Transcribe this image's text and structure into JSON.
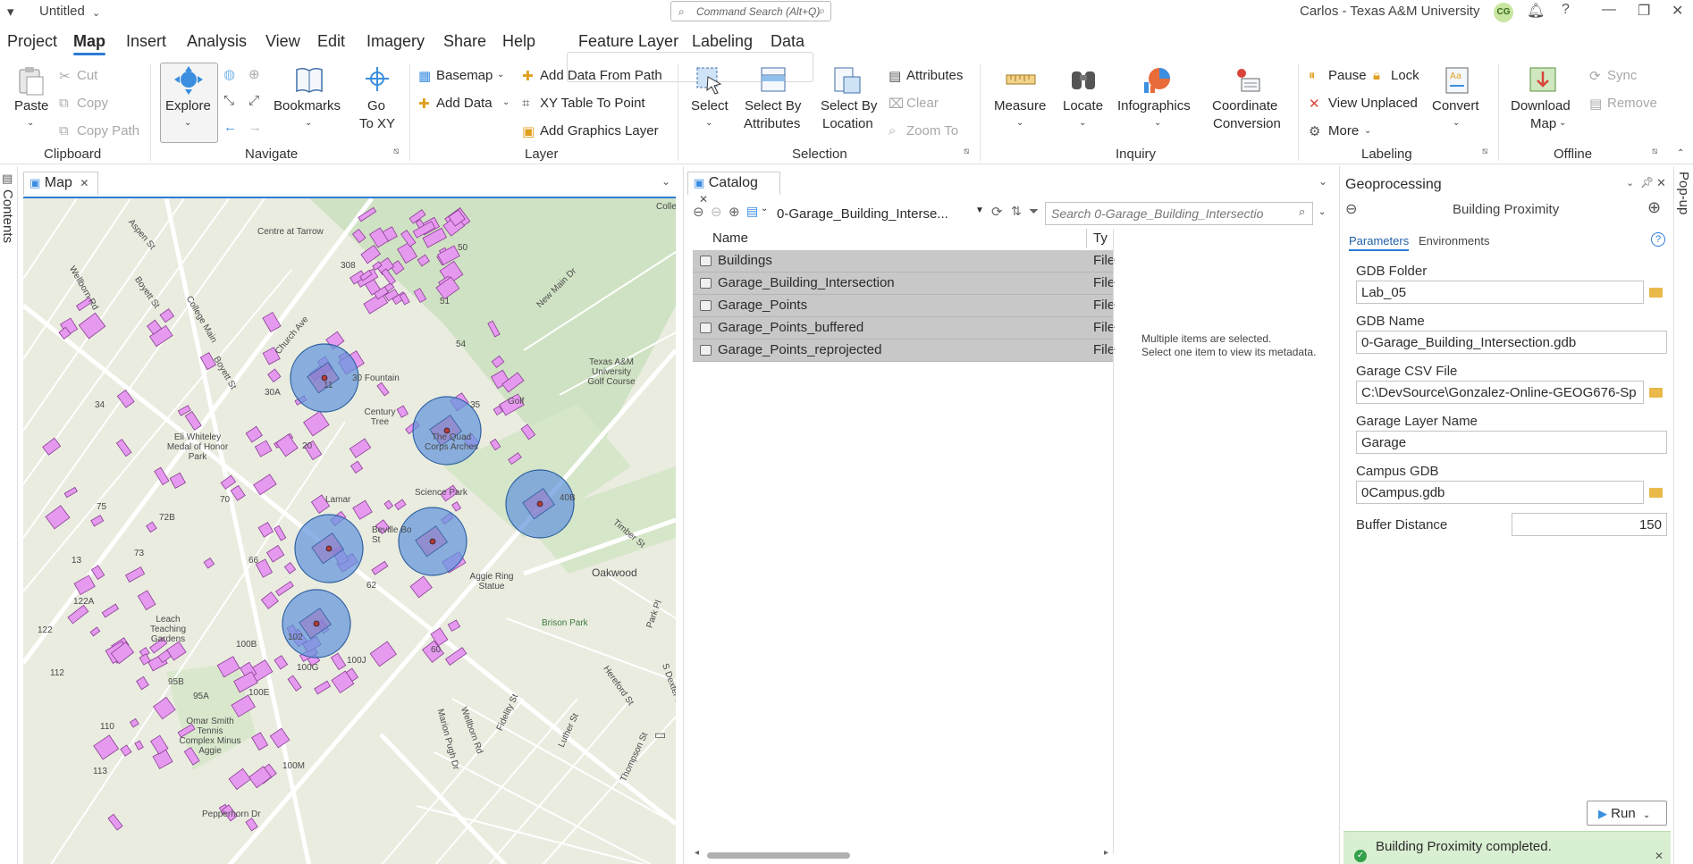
{
  "titlebar": {
    "doc_title": "Untitled",
    "search_placeholder": "Command Search (Alt+Q)",
    "user": "Carlos - Texas A&M University",
    "avatar_initials": "CG"
  },
  "menu": {
    "tabs": [
      "Project",
      "Map",
      "Insert",
      "Analysis",
      "View",
      "Edit",
      "Imagery",
      "Share",
      "Help"
    ],
    "active": "Map",
    "context_tabs": [
      "Feature Layer",
      "Labeling",
      "Data"
    ]
  },
  "ribbon": {
    "clipboard": {
      "label": "Clipboard",
      "paste": "Paste",
      "cut": "Cut",
      "copy": "Copy",
      "copy_path": "Copy Path"
    },
    "navigate": {
      "label": "Navigate",
      "explore": "Explore",
      "bookmarks": "Bookmarks",
      "goto_line1": "Go",
      "goto_line2": "To XY"
    },
    "layer": {
      "label": "Layer",
      "basemap": "Basemap",
      "add_data": "Add Data",
      "add_data_from_path": "Add Data From Path",
      "xy_table": "XY Table To Point",
      "add_graphics": "Add Graphics Layer"
    },
    "selection": {
      "label": "Selection",
      "select": "Select",
      "by_attr_1": "Select By",
      "by_attr_2": "Attributes",
      "by_loc_1": "Select By",
      "by_loc_2": "Location",
      "attributes": "Attributes",
      "clear": "Clear",
      "zoom_to": "Zoom To"
    },
    "inquiry": {
      "label": "Inquiry",
      "measure": "Measure",
      "locate": "Locate",
      "infographics": "Infographics",
      "coord_1": "Coordinate",
      "coord_2": "Conversion"
    },
    "labeling": {
      "label": "Labeling",
      "pause": "Pause",
      "lock": "Lock",
      "view_unplaced": "View Unplaced",
      "more": "More",
      "convert": "Convert"
    },
    "offline": {
      "label": "Offline",
      "download_1": "Download",
      "download_2": "Map",
      "sync": "Sync",
      "remove": "Remove"
    }
  },
  "sidepanels": {
    "contents": "Contents",
    "popup": "Pop-up"
  },
  "map_pane": {
    "tab_label": "Map",
    "labels": {
      "aspen": "Aspen St",
      "wellborn": "Wellborn Rd",
      "boyett": "Boyett St",
      "college_main": "College Main",
      "boyett2": "Boyett St",
      "church": "Church Ave",
      "centre": "Centre at Tarrow",
      "r308": "308",
      "coll": "Colle Est",
      "n50": "50",
      "n51": "51",
      "n54": "54",
      "new_main": "New Main Dr",
      "tamu_golf": "Texas A&M University Golf Course",
      "golf": "Golf",
      "n11": "11",
      "fountain": "30 Fountain",
      "n30a": "30A",
      "century": "Century Tree",
      "n35": "35",
      "quad": "The Quad Corps Arches",
      "whiteley": "Eli Whiteley Medal of Honor Park",
      "n20": "20",
      "n34": "34",
      "n70": "70",
      "n75": "75",
      "n72b": "72B",
      "n73": "73",
      "n13": "13",
      "n40b": "40B",
      "lamar": "Lamar",
      "science": "Science Park",
      "beville": "Beville Bo St",
      "timber": "Timber St",
      "oakwood": "Oakwood",
      "aggie_ring": "Aggie Ring Statue",
      "n66": "66",
      "n62": "62",
      "n122a": "122A",
      "leach": "Leach Teaching Gardens",
      "n122": "122",
      "n112": "112",
      "n102": "102",
      "n100b": "100B",
      "n100g": "100G",
      "n100j": "100J",
      "n60": "60",
      "brison": "Brison Park",
      "park_pl": "Park Pl",
      "s_dexter": "S Dexter Dr",
      "n95b": "95B",
      "n95a": "95A",
      "n100e": "100E",
      "hereford": "Hereford St",
      "fidelity": "Fidelity St",
      "luther": "Luther St",
      "thompson": "Thompson St",
      "omar": "Omar Smith Tennis Complex Minus Aggie",
      "n110": "110",
      "marion": "Marion Pugh Dr",
      "wellborn2": "Wellborn Rd",
      "n113": "113",
      "n100m": "100M",
      "pepperhorn": "Pepperhorn Dr"
    }
  },
  "catalog": {
    "tab_label": "Catalog",
    "path": "0-Garage_Building_Interse...",
    "search_placeholder": "Search 0-Garage_Building_Intersectio",
    "col_name": "Name",
    "col_type": "Ty",
    "rows": [
      {
        "name": "Buildings",
        "type": "File"
      },
      {
        "name": "Garage_Building_Intersection",
        "type": "File"
      },
      {
        "name": "Garage_Points",
        "type": "File"
      },
      {
        "name": "Garage_Points_buffered",
        "type": "File"
      },
      {
        "name": "Garage_Points_reprojected",
        "type": "File"
      }
    ],
    "metadata_line1": "Multiple items are selected.",
    "metadata_line2": "Select one item to view its metadata."
  },
  "geoprocessing": {
    "title": "Geoprocessing",
    "tool": "Building Proximity",
    "tabs": [
      "Parameters",
      "Environments"
    ],
    "params": {
      "gdb_folder_label": "GDB Folder",
      "gdb_folder": "Lab_05",
      "gdb_name_label": "GDB Name",
      "gdb_name": "0-Garage_Building_Intersection.gdb",
      "csv_label": "Garage CSV File",
      "csv": "C:\\DevSource\\Gonzalez-Online-GEOG676-Sp",
      "layer_label": "Garage Layer Name",
      "layer": "Garage",
      "campus_label": "Campus GDB",
      "campus": "0Campus.gdb",
      "buffer_label": "Buffer Distance",
      "buffer": "150"
    },
    "run": "Run",
    "status": "Building Proximity completed."
  }
}
